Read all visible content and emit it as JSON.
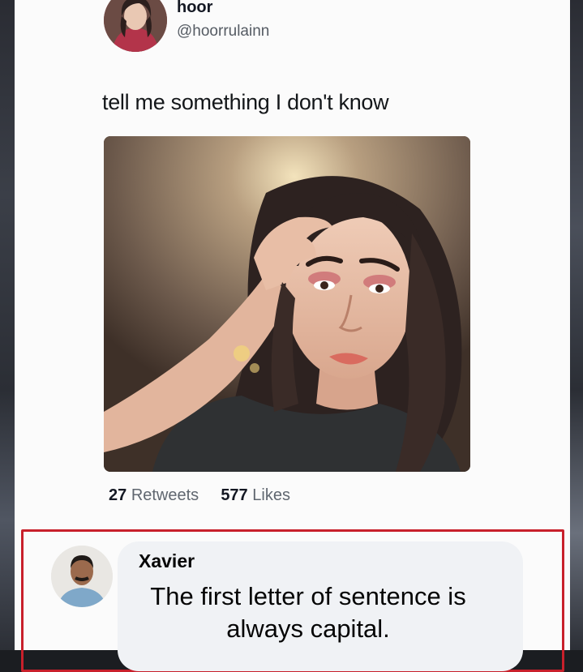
{
  "tweet": {
    "display_name": "hoor",
    "handle": "@hoorrulainn",
    "text": "tell me something I don't know",
    "retweets_count": "27",
    "retweets_label": "Retweets",
    "likes_count": "577",
    "likes_label": "Likes"
  },
  "reply": {
    "name": "Xavier",
    "text": "The first letter of sentence is always capital."
  },
  "colors": {
    "highlight_border": "#c8202b",
    "bubble_bg": "#f0f2f5",
    "card_bg": "#fbfbfb"
  }
}
